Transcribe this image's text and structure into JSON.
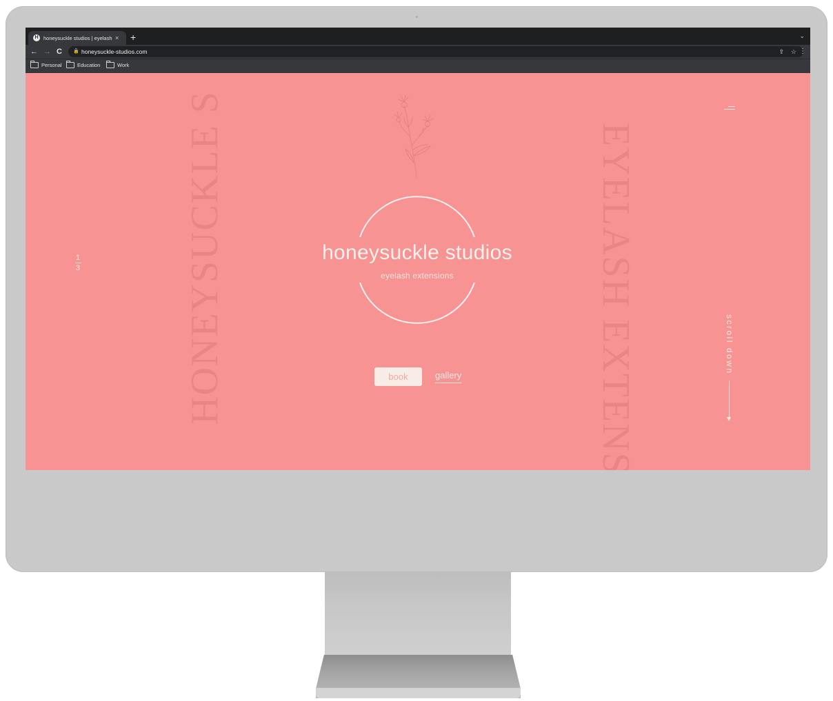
{
  "browser": {
    "tab_title": "honeysuckle studios | eyelash extensions",
    "tab_favicon_letter": "H",
    "tab_close": "×",
    "new_tab": "+",
    "tab_list": "⌄",
    "url": "honeysuckle-studios.com",
    "bookmarks": [
      "Personal",
      "Education",
      "Work"
    ]
  },
  "site": {
    "vertical_left": "HONEYSUCKLE S",
    "vertical_right": "EYELASH EXTENS",
    "pager_current": "1",
    "pager_total": "3",
    "brand": "honeysuckle studios",
    "tagline": "eyelash extensions",
    "book_label": "book",
    "gallery_label": "gallery",
    "scroll_label": "scroll down"
  },
  "colors": {
    "site_background": "#f79493",
    "accent_text": "#fdf0ec",
    "big_text": "#e98584",
    "chrome_dark": "#1e1f21",
    "chrome_toolbar": "#36383c",
    "bezel": "#c9c9c9"
  }
}
